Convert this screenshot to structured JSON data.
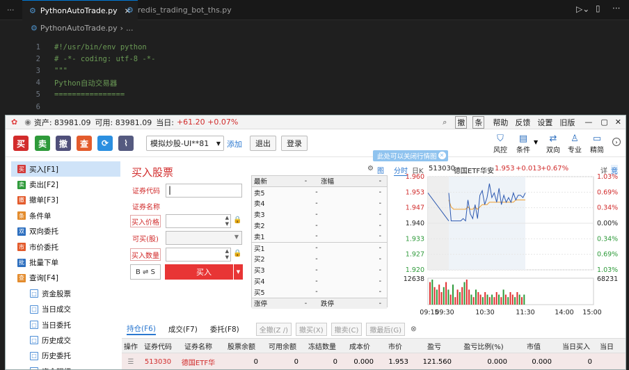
{
  "editor": {
    "tabs": [
      {
        "label": "PythonAutoTrade.py",
        "close": "×"
      },
      {
        "label": "redis_trading_bot_ths.py"
      }
    ],
    "breadcrumb": {
      "file": "PythonAutoTrade.py",
      "sep": "›",
      "rest": "..."
    },
    "lines": [
      {
        "num": "1",
        "text": "#!/usr/bin/env python"
      },
      {
        "num": "2",
        "text": "# -*- coding: utf-8 -*-"
      },
      {
        "num": "3",
        "text": "\"\"\""
      },
      {
        "num": "4",
        "text": "Python自动交易器"
      },
      {
        "num": "5",
        "text": "================"
      },
      {
        "num": "6",
        "text": ""
      }
    ]
  },
  "app": {
    "title": {
      "assets": "资产: 83981.09",
      "avail": "可用: 83981.09",
      "today": "当日:",
      "change": "+61.20 +0.07%"
    },
    "top_buttons": {
      "withdraw": "撤",
      "strategy": "条",
      "help": "帮助",
      "feedback": "反馈",
      "settings": "设置",
      "old": "旧版"
    },
    "toolbar": {
      "buy": "买",
      "sell": "卖",
      "cancel": "撤",
      "query": "查",
      "account": "模拟炒股-UI**81",
      "add": "添加",
      "logout": "退出",
      "login": "登录"
    },
    "right_icons": [
      {
        "label": "风控"
      },
      {
        "label": "条件"
      },
      {
        "label": "双向"
      },
      {
        "label": "专业"
      },
      {
        "label": "精简"
      }
    ],
    "tooltip": "此处可以关闭行情图",
    "sidebar": [
      {
        "label": "买入[F1]",
        "badge": "买",
        "color": "#d23a3a",
        "sel": true
      },
      {
        "label": "卖出[F2]",
        "badge": "卖",
        "color": "#2e9a3a"
      },
      {
        "label": "撤单[F3]",
        "badge": "撤",
        "color": "#e35b2c"
      },
      {
        "label": "条件单",
        "badge": "条",
        "color": "#e38b2c"
      },
      {
        "label": "双向委托",
        "badge": "双",
        "color": "#2d6fbf"
      },
      {
        "label": "市价委托",
        "badge": "市",
        "color": "#e35b2c"
      },
      {
        "label": "批量下单",
        "badge": "批",
        "color": "#2d6fbf"
      },
      {
        "label": "查询[F4]",
        "badge": "查",
        "color": "#e38b2c"
      },
      {
        "label": "资金股票",
        "badge": "□",
        "color": "#4a8cd6",
        "sub": true
      },
      {
        "label": "当日成交",
        "badge": "□",
        "color": "#4a8cd6",
        "sub": true
      },
      {
        "label": "当日委托",
        "badge": "□",
        "color": "#4a8cd6",
        "sub": true
      },
      {
        "label": "历史成交",
        "badge": "□",
        "color": "#4a8cd6",
        "sub": true
      },
      {
        "label": "历史委托",
        "badge": "□",
        "color": "#4a8cd6",
        "sub": true
      },
      {
        "label": "资金明细",
        "badge": "□",
        "color": "#4a8cd6",
        "sub": true
      }
    ],
    "form": {
      "title": "买入股票",
      "code_label": "证券代码",
      "name_label": "证券名称",
      "price_label": "买入价格",
      "avail_label": "可买(股)",
      "qty_label": "买入数量",
      "switch": "B ⇌ S",
      "buy": "买入"
    },
    "orderbook": {
      "header": [
        "最新",
        "-",
        "涨幅",
        "-"
      ],
      "sells": [
        [
          "卖5",
          "-",
          "-"
        ],
        [
          "卖4",
          "-",
          "-"
        ],
        [
          "卖3",
          "-",
          "-"
        ],
        [
          "卖2",
          "-",
          "-"
        ],
        [
          "卖1",
          "-",
          "-"
        ]
      ],
      "buys": [
        [
          "买1",
          "-",
          "-"
        ],
        [
          "买2",
          "-",
          "-"
        ],
        [
          "买3",
          "-",
          "-"
        ],
        [
          "买4",
          "-",
          "-"
        ],
        [
          "买5",
          "-",
          "-"
        ]
      ],
      "footer": [
        "涨停",
        "-",
        "跌停",
        "-"
      ]
    },
    "quote": {
      "tab1": "分时",
      "tab2": "日K",
      "code": "513030",
      "name": "德国ETF华安",
      "price": "1.953",
      "change": "+0.013",
      "pct": "+0.67%",
      "btn1": "详",
      "btn2": "竞"
    },
    "bottom_tabs": [
      {
        "label": "持仓(F6)",
        "active": true
      },
      {
        "label": "成交(F7)"
      },
      {
        "label": "委托(F8)"
      }
    ],
    "bottom_btns": [
      "全撤(Z /)",
      "撤买(X)",
      "撤卖(C)",
      "撤最后(G)"
    ],
    "table": {
      "headers": [
        "操作",
        "证券代码",
        "证券名称",
        "股票余额",
        "可用余额",
        "冻结数量",
        "成本价",
        "市价",
        "盈亏",
        "盈亏比例(%)",
        "市值",
        "当日买入",
        "当日"
      ],
      "rows": [
        [
          "",
          "513030",
          "德国ETF华",
          "0",
          "0",
          "0",
          "0.000",
          "1.953",
          "121.560",
          "0.000",
          "0.000",
          "0",
          ""
        ]
      ]
    }
  },
  "chart_data": {
    "type": "line",
    "title": "",
    "price_ticks": [
      "1.960",
      "1.953",
      "1.947",
      "1.940",
      "1.933",
      "1.927",
      "1.920"
    ],
    "pct_ticks": [
      "1.03%",
      "0.69%",
      "0.34%",
      "0.00%",
      "0.34%",
      "0.69%",
      "1.03%"
    ],
    "vol_ticks": [
      "12638",
      "68231"
    ],
    "time_ticks": [
      "09:15",
      "09:30",
      "10:30",
      "11:30",
      "14:00",
      "15:00"
    ],
    "ylim": [
      1.92,
      1.96
    ],
    "series": [
      {
        "values": [
          1.953,
          1.941,
          1.941,
          1.941,
          1.941,
          1.941,
          1.942,
          1.941,
          1.95,
          1.944,
          1.942,
          1.948,
          1.942,
          1.952,
          1.954,
          1.948,
          1.951,
          1.957,
          1.951,
          1.953,
          1.949,
          1.955,
          1.948,
          1.952,
          1.949,
          1.951,
          1.949,
          1.953,
          1.95,
          1.952,
          1.952,
          1.951,
          1.953
        ]
      }
    ],
    "avg": [
      1.95,
      1.947,
      1.946,
      1.946,
      1.946,
      1.946,
      1.946,
      1.946,
      1.947,
      1.946,
      1.946,
      1.947,
      1.946,
      1.947,
      1.948,
      1.948,
      1.948,
      1.949,
      1.949,
      1.949,
      1.949,
      1.949,
      1.949,
      1.949,
      1.949,
      1.949,
      1.949,
      1.949,
      1.95,
      1.95,
      1.95,
      1.95,
      1.95
    ],
    "volume": [
      9,
      10,
      7,
      6,
      8,
      5,
      7,
      9,
      6,
      4,
      8,
      3,
      6,
      5,
      7,
      9,
      10,
      6,
      4,
      3,
      6,
      5,
      4,
      3,
      5,
      4,
      3,
      4,
      3,
      5,
      4,
      3,
      6,
      4,
      3,
      5,
      4,
      3,
      5,
      4,
      3,
      4
    ],
    "vol_colors": [
      "r",
      "g",
      "r",
      "g",
      "r",
      "r",
      "g",
      "r",
      "g",
      "r",
      "g",
      "r",
      "r",
      "g",
      "r",
      "g",
      "r",
      "r",
      "g",
      "r",
      "g",
      "r",
      "r",
      "g",
      "r",
      "g",
      "r",
      "g",
      "r",
      "r",
      "g",
      "r",
      "g",
      "r",
      "g",
      "r",
      "r",
      "g",
      "r",
      "g",
      "r",
      "g"
    ]
  }
}
